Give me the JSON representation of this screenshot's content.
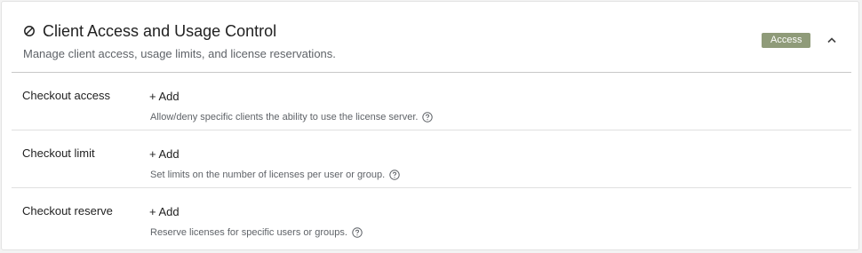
{
  "panel": {
    "title": "Client Access and Usage Control",
    "subtitle": "Manage client access, usage limits, and license reservations.",
    "badge": "Access",
    "badge_color": "#8f9b79",
    "title_icon": "ban-icon",
    "collapse_icon": "chevron-up-icon"
  },
  "rows": [
    {
      "label": "Checkout access",
      "add_label": "+ Add",
      "hint": "Allow/deny specific clients the ability to use the license server.",
      "help_icon": "question-circle-icon"
    },
    {
      "label": "Checkout limit",
      "add_label": "+ Add",
      "hint": "Set limits on the number of licenses per user or group.",
      "help_icon": "question-circle-icon"
    },
    {
      "label": "Checkout reserve",
      "add_label": "+ Add",
      "hint": "Reserve licenses for specific users or groups.",
      "help_icon": "question-circle-icon"
    }
  ]
}
